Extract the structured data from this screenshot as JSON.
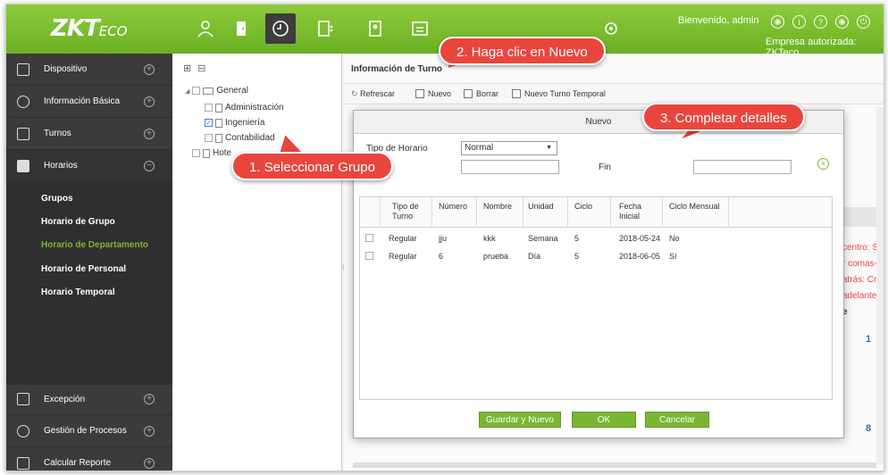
{
  "header": {
    "logo_main": "ZKT",
    "logo_sub": "ECO",
    "welcome": "Bienvenido, admin",
    "company": "Empresa autorizada: ZKTeco"
  },
  "sidebar": {
    "items": [
      {
        "label": "Dispositivo",
        "toggle": "+"
      },
      {
        "label": "Información Básica",
        "toggle": "+"
      },
      {
        "label": "Turnos",
        "toggle": "+"
      },
      {
        "label": "Horarios",
        "toggle": "−"
      },
      {
        "label": "Excepción",
        "toggle": "+"
      },
      {
        "label": "Gestión de Procesos",
        "toggle": "+"
      },
      {
        "label": "Calcular Reporte",
        "toggle": "+"
      }
    ],
    "submenu": [
      "Grupos",
      "Horario de Grupo",
      "Horario de Departamento",
      "Horario de Personal",
      "Horario Temporal"
    ]
  },
  "tree": {
    "root": "General",
    "children": [
      "Administración",
      "Ingeniería",
      "Contabilidad"
    ],
    "partial": "Hote"
  },
  "main": {
    "title": "Información de Turno",
    "toolbar": {
      "refresh": "Refrescar",
      "new": "Nuevo",
      "delete": "Borrar",
      "new_temp": "Nuevo Turno Temporal"
    },
    "bg_fragments": [
      "centro: Sí",
      "r comas-",
      "atrás: Cr",
      "adelante",
      "e",
      "1",
      "8"
    ]
  },
  "dialog": {
    "title": "Nuevo",
    "schedule_type_label": "Tipo de Horario",
    "schedule_type_value": "Normal",
    "end_label": "Fin",
    "columns": [
      "Tipo de Turno",
      "Número",
      "Nombre",
      "Unidad",
      "Ciclo",
      "Fecha Inicial",
      "Ciclo Mensual"
    ],
    "rows": [
      [
        "Regular",
        "jju",
        "kkk",
        "Semana",
        "5",
        "2018-05-24",
        "No"
      ],
      [
        "Regular",
        "6",
        "prueba",
        "Día",
        "5",
        "2018-06-05",
        "Sí"
      ]
    ],
    "buttons": {
      "save_new": "Guardar y Nuevo",
      "ok": "OK",
      "cancel": "Cancelar"
    }
  },
  "callouts": {
    "step1": "1. Seleccionar Grupo",
    "step2": "2. Haga clic en Nuevo",
    "step3": "3. Completar detalles"
  },
  "colors": {
    "header_green": "#7ab634",
    "sidebar_dark": "#3b3b3b",
    "callout_red": "#e8463d"
  }
}
